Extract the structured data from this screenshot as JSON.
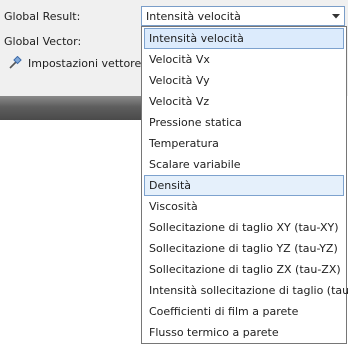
{
  "global_result": {
    "label": "Global Result:",
    "selected_value": "Intensità velocità",
    "options": [
      "Intensità velocità",
      "Velocità Vx",
      "Velocità Vy",
      "Velocità Vz",
      "Pressione statica",
      "Temperatura",
      "Scalare variabile",
      "Densità",
      "Viscosità",
      "Sollecitazione di taglio XY (tau-XY)",
      "Sollecitazione di taglio YZ (tau-YZ)",
      "Sollecitazione di taglio ZX (tau-ZX)",
      "Intensità sollecitazione di taglio (tau)",
      "Coefficienti di film a parete",
      "Flusso termico a parete"
    ],
    "highlighted_index": 0,
    "hover_index": 7
  },
  "global_vector": {
    "label": "Global Vector:"
  },
  "settings": {
    "label": "Impostazioni vettore",
    "icon": "pin-icon"
  },
  "colors": {
    "selection_fill": "#dcebfc",
    "selection_border": "#7da2ce",
    "combo_border": "#7a9dc8"
  }
}
